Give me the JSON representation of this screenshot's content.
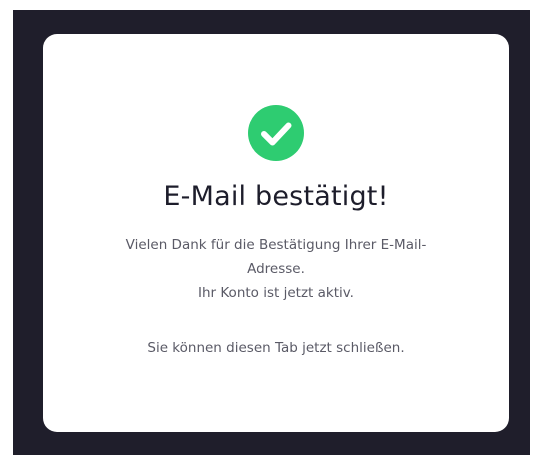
{
  "colors": {
    "backdrop": "#1f1e2b",
    "card": "#ffffff",
    "success": "#2ecc71",
    "title": "#1d1d2b",
    "text": "#5a5a66"
  },
  "icon": "check-circle-icon",
  "card": {
    "title": "E-Mail bestätigt!",
    "message_line1": "Vielen Dank für die Bestätigung Ihrer E-Mail-",
    "message_line2": "Adresse.",
    "message_line3": "Ihr Konto ist jetzt aktiv.",
    "hint": "Sie können diesen Tab jetzt schließen."
  }
}
